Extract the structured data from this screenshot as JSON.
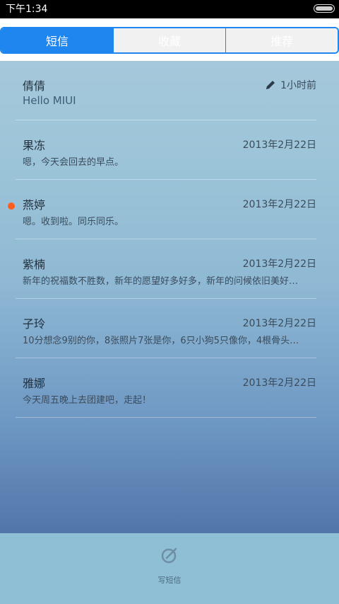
{
  "status_bar": {
    "time": "下午1:34"
  },
  "tabs": [
    {
      "label": "短信",
      "active": true
    },
    {
      "label": "收藏",
      "active": false
    },
    {
      "label": "推荐",
      "active": false
    }
  ],
  "conversations": [
    {
      "name": "倩倩",
      "preview": "Hello MIUI",
      "time": "1小时前",
      "draft": true,
      "unread": false
    },
    {
      "name": "果冻",
      "preview": "嗯，今天会回去的早点。",
      "time": "2013年2月22日",
      "draft": false,
      "unread": false
    },
    {
      "name": "燕婷",
      "preview": "嗯。收到啦。同乐同乐。",
      "time": "2013年2月22日",
      "draft": false,
      "unread": true
    },
    {
      "name": "紫楠",
      "preview": "新年的祝福数不胜数，新年的愿望好多好多，新年的问候依旧美好…",
      "time": "2013年2月22日",
      "draft": false,
      "unread": false
    },
    {
      "name": "子玲",
      "preview": "10分想念9别的你，8张照片7张是你，6只小狗5只像你，4根骨头…",
      "time": "2013年2月22日",
      "draft": false,
      "unread": false
    },
    {
      "name": "雅娜",
      "preview": "今天周五晚上去团建吧，走起！",
      "time": "2013年2月22日",
      "draft": false,
      "unread": false
    }
  ],
  "compose": {
    "label": "写短信",
    "icon": "compose-icon"
  },
  "colors": {
    "accent": "#1f86f0",
    "unread_dot": "#ff5d1e"
  }
}
